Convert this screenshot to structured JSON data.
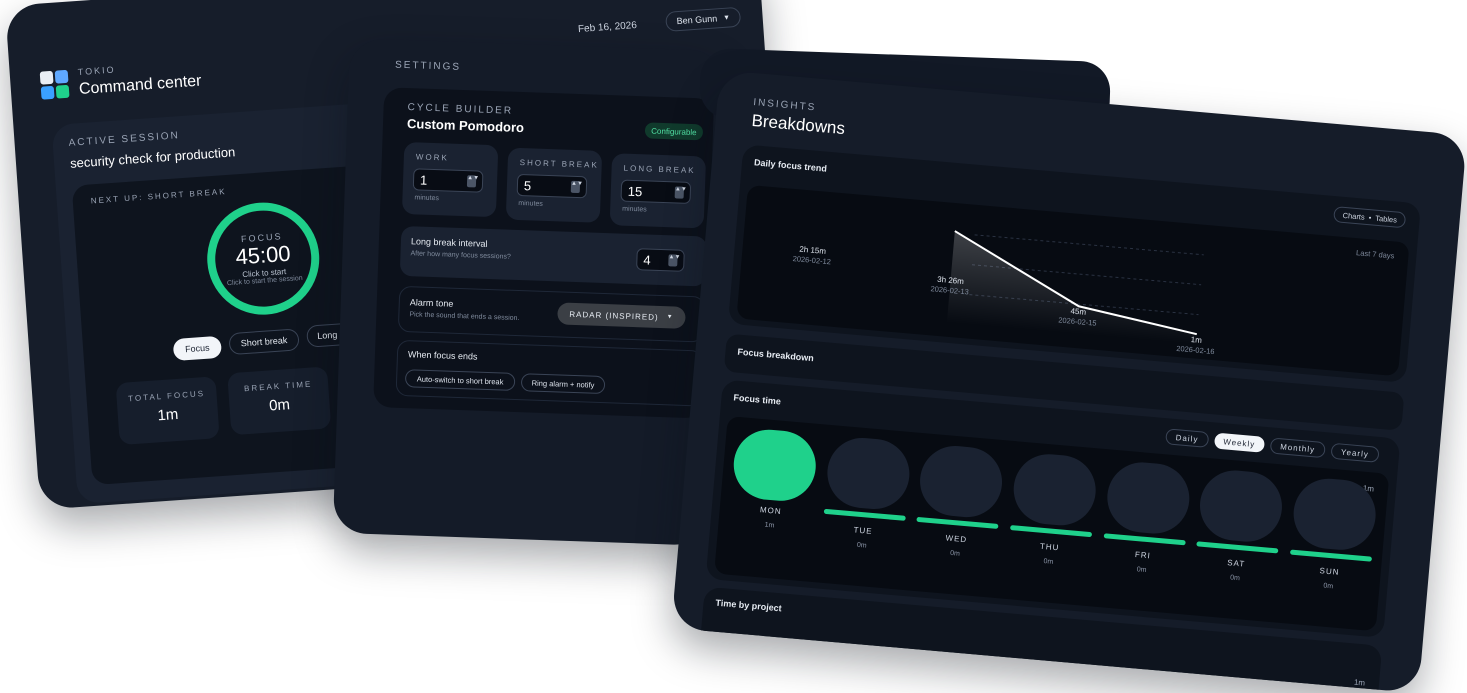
{
  "command_center": {
    "brand_small": "TOKIO",
    "title": "Command center",
    "date": "Feb 16, 2026",
    "user": "Ben Gunn",
    "active_session_label": "ACTIVE SESSION",
    "session_title": "security check for production",
    "next_up": "NEXT UP: SHORT BREAK",
    "timer": {
      "mode": "FOCUS",
      "time": "45:00",
      "hint": "Click to start",
      "hint_overlay": "Click to start the session"
    },
    "mode_buttons": [
      "Focus",
      "Short break",
      "Long break"
    ],
    "stats": [
      {
        "label": "TOTAL FOCUS",
        "value": "1m"
      },
      {
        "label": "BREAK TIME",
        "value": "0m"
      }
    ]
  },
  "settings": {
    "heading": "SETTINGS",
    "cycle_label": "CYCLE BUILDER",
    "cycle_title": "Custom Pomodoro",
    "badge": "Configurable",
    "fields": [
      {
        "label": "WORK",
        "value": "1",
        "unit": "minutes"
      },
      {
        "label": "SHORT BREAK",
        "value": "5",
        "unit": "minutes"
      },
      {
        "label": "LONG BREAK",
        "value": "15",
        "unit": "minutes"
      }
    ],
    "long_break_interval": {
      "title": "Long break interval",
      "subtitle": "After how many focus sessions?",
      "value": "4"
    },
    "alarm": {
      "title": "Alarm tone",
      "subtitle": "Pick the sound that ends a session.",
      "value": "RADAR (INSPIRED)"
    },
    "when_focus_ends": {
      "title": "When focus ends",
      "options": [
        "Auto-switch to short break",
        "Ring alarm + notify"
      ]
    }
  },
  "insights": {
    "heading": "INSIGHTS",
    "title": "Breakdowns",
    "trend_title": "Daily focus trend",
    "view_toggle": [
      "Charts",
      "Tables"
    ],
    "range_label": "Last 7 days",
    "trend_points": [
      {
        "value": "2h 15m",
        "date": "2026-02-12"
      },
      {
        "value": "3h 26m",
        "date": "2026-02-13"
      },
      {
        "value": "45m",
        "date": "2026-02-15"
      },
      {
        "value": "1m",
        "date": "2026-02-16"
      }
    ],
    "focus_breakdown_title": "Focus breakdown",
    "focus_time_title": "Focus time",
    "periods": [
      "Daily",
      "Weekly",
      "Monthly",
      "Yearly"
    ],
    "active_period": "Weekly",
    "max_label": "1m",
    "days": [
      {
        "day": "MON",
        "value": "1m",
        "active": true
      },
      {
        "day": "TUE",
        "value": "0m",
        "active": false
      },
      {
        "day": "WED",
        "value": "0m",
        "active": false
      },
      {
        "day": "THU",
        "value": "0m",
        "active": false
      },
      {
        "day": "FRI",
        "value": "0m",
        "active": false
      },
      {
        "day": "SAT",
        "value": "0m",
        "active": false
      },
      {
        "day": "SUN",
        "value": "0m",
        "active": false
      }
    ],
    "time_by_project_title": "Time by project",
    "project_max_label": "1m"
  },
  "chart_data": {
    "type": "line",
    "title": "Daily focus trend",
    "x": [
      "2026-02-12",
      "2026-02-13",
      "2026-02-15",
      "2026-02-16"
    ],
    "values": [
      135,
      206,
      45,
      1
    ],
    "value_labels": [
      "2h 15m",
      "3h 26m",
      "45m",
      "1m"
    ],
    "ylabel": ""
  },
  "colors": {
    "accent": "#1fd18b",
    "card": "#141b28",
    "panel": "#0c111b"
  }
}
